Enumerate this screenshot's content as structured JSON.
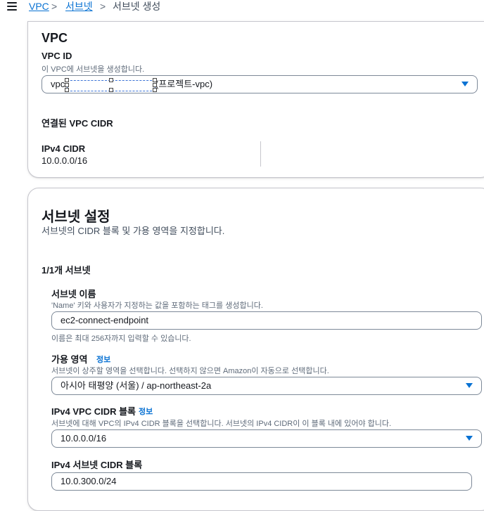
{
  "breadcrumb": {
    "vpc": "VPC",
    "subnets": "서브넷",
    "current": "서브넷 생성",
    "separator": ">"
  },
  "vpc_section": {
    "title": "VPC",
    "vpc_id_label": "VPC ID",
    "vpc_id_desc": "이 VPC에 서브넷을 생성합니다.",
    "vpc_select_prefix": "vpc",
    "vpc_select_suffix": "(프로젝트-vpc)",
    "linked_cidr_title": "연결된 VPC CIDR",
    "ipv4_cidr_label": "IPv4 CIDR",
    "ipv4_cidr_value": "10.0.0.0/16"
  },
  "subnet_settings": {
    "title": "서브넷 설정",
    "desc": "서브넷의 CIDR 블록 및 가용 영역을 지정합니다.",
    "count_label": "1/1개 서브넷",
    "name_label": "서브넷 이름",
    "name_desc": "'Name' 키와 사용자가 지정하는 값을 포함하는 태그를 생성합니다.",
    "name_value": "ec2-connect-endpoint",
    "name_hint": "이름은 최대 256자까지 입력할 수 있습니다.",
    "az_label": "가용 영역",
    "az_info": "정보",
    "az_desc": "서브넷이 상주할 영역을 선택합니다. 선택하지 않으면 Amazon이 자동으로 선택합니다.",
    "az_value": "아시아 태평양 (서울) / ap-northeast-2a",
    "vpc_cidr_label": "IPv4 VPC CIDR 블록",
    "vpc_cidr_info": "정보",
    "vpc_cidr_desc": "서브넷에 대해 VPC의 IPv4 CIDR 블록을 선택합니다. 서브넷의 IPv4 CIDR이 이 블록 내에 있어야 합니다.",
    "vpc_cidr_value": "10.0.0.0/16",
    "subnet_cidr_label": "IPv4 서브넷 CIDR 블록",
    "subnet_cidr_value": "10.0.300.0/24"
  },
  "colors": {
    "link": "#0972d3",
    "border": "#7d8998",
    "text": "#16191f",
    "muted": "#5f6b7a"
  },
  "icons": [
    "menu-icon",
    "chevron-right-icon",
    "caret-down-icon"
  ]
}
